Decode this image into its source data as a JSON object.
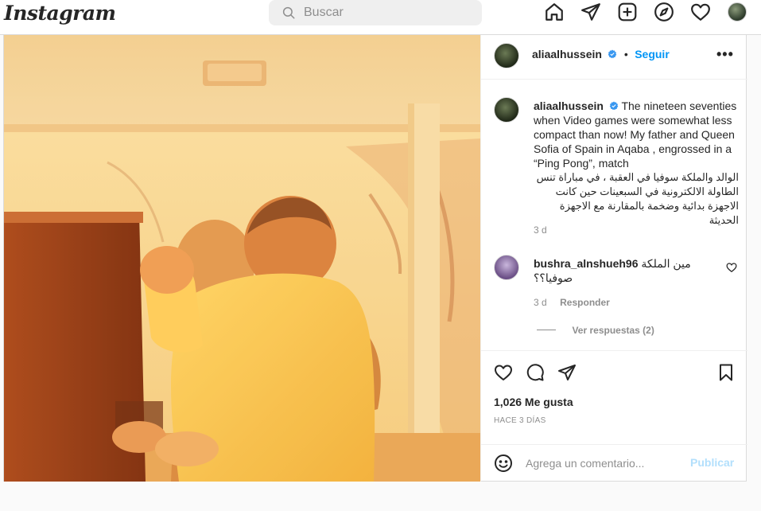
{
  "app": {
    "logo": "Instagram"
  },
  "search": {
    "placeholder": "Buscar"
  },
  "nav": {
    "icons": [
      "home-icon",
      "direct-icon",
      "new-post-icon",
      "explore-icon",
      "activity-icon",
      "profile-avatar"
    ]
  },
  "post": {
    "author": {
      "username": "aliaalhussein",
      "verified": true,
      "follow_label": "Seguir"
    },
    "more_label": "•••",
    "caption": {
      "username": "aliaalhussein",
      "text_en": "The nineteen seventies when Video games were somewhat less compact than now! My father and Queen Sofia of Spain in Aqaba , engrossed in a “Ping Pong”, match",
      "text_ar": "الوالد والملكة سوفيا في العقبة ، في مباراة تنس الطاولة الالكترونية في السبعينات حين كانت الاجهزة بدائية وضخمة بالمقارنة مع الاجهزة الحديثة",
      "time": "3 d"
    },
    "comments": [
      {
        "username": "bushra_alnshueh96",
        "text": "مين الملكة صوفيا؟؟",
        "time": "3 d",
        "reply_label": "Responder",
        "view_replies": "Ver respuestas (2)"
      }
    ],
    "likes": "1,026 Me gusta",
    "posted_ago": "HACE 3 DÍAS",
    "comment_input_placeholder": "Agrega un comentario...",
    "publish_label": "Publicar"
  },
  "colors": {
    "accent": "#0095f6",
    "publish_disabled": "#b2dffc",
    "verified": "#3897f0"
  }
}
